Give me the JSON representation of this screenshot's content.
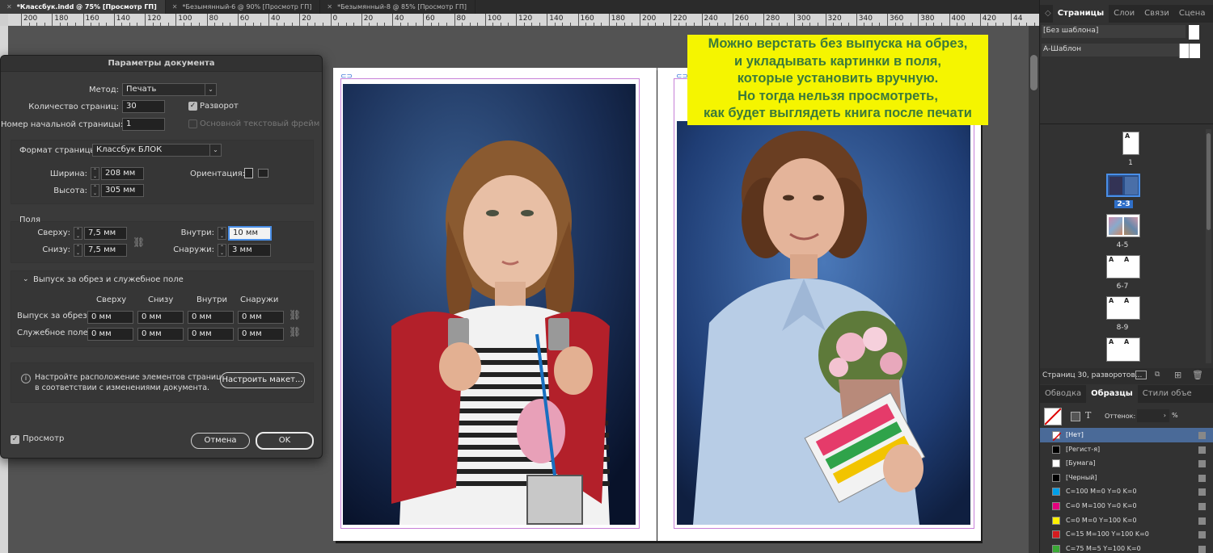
{
  "tabs": [
    {
      "label": "*Классбук.indd @ 75% [Просмотр ГП]"
    },
    {
      "label": "*Безымянный-6 @ 90% [Просмотр ГП]"
    },
    {
      "label": "*Безымянный-8 @ 85% [Просмотр ГП]"
    }
  ],
  "ruler": {
    "labels": [
      "200",
      "180",
      "160",
      "140",
      "120",
      "100",
      "80",
      "60",
      "40",
      "20",
      "0",
      "20",
      "40",
      "60",
      "80",
      "100",
      "120",
      "140",
      "160",
      "180",
      "200",
      "220",
      "240",
      "260",
      "280",
      "300",
      "320",
      "340",
      "360",
      "380",
      "400",
      "420",
      "44"
    ]
  },
  "note": {
    "lines": [
      "Можно верстать без выпуска на обрез,",
      "и укладывать картинки в поля,",
      "которые установить вручную.",
      "Но тогда нельзя просмотреть,",
      "как будет выглядеть книга после печати"
    ]
  },
  "dialog": {
    "title": "Параметры документа",
    "method_label": "Метод:",
    "method_value": "Печать",
    "pages_label": "Количество страниц:",
    "pages_value": "30",
    "spread_label": "Разворот",
    "start_page_label": "Номер начальной страницы:",
    "start_page_value": "1",
    "primary_text_frame_label": "Основной текстовый фрейм",
    "page_size_label": "Формат страницы:",
    "page_size_value": "Классбук БЛОК",
    "width_label": "Ширина:",
    "width_value": "208 мм",
    "height_label": "Высота:",
    "height_value": "305 мм",
    "orientation_label": "Ориентация:",
    "margins_label": "Поля",
    "top_label": "Сверху:",
    "top_value": "7,5 мм",
    "bottom_label": "Снизу:",
    "bottom_value": "7,5 мм",
    "inside_label": "Внутри:",
    "inside_value": "10 мм",
    "outside_label": "Снаружи:",
    "outside_value": "3 мм",
    "bleed_section_label": "Выпуск за обрез и служебное поле",
    "col_top": "Сверху",
    "col_bottom": "Снизу",
    "col_inside": "Внутри",
    "col_outside": "Снаружи",
    "bleed_label": "Выпуск за обрез:",
    "slug_label": "Служебное поле:",
    "bleed_values": [
      "0 мм",
      "0 мм",
      "0 мм",
      "0 мм"
    ],
    "slug_values": [
      "0 мм",
      "0 мм",
      "0 мм",
      "0 мм"
    ],
    "info_text_1": "Настройте расположение элементов страницы",
    "info_text_2": "в соответствии с изменениями документа.",
    "adjust_button": "Настроить макет...",
    "preview_label": "Просмотр",
    "cancel_button": "Отмена",
    "ok_button": "OK"
  },
  "pages_panel": {
    "tabs": [
      "Страницы",
      "Слои",
      "Связи",
      "Сцена"
    ],
    "none_master": "[Без шаблона]",
    "a_master": "A-Шаблон",
    "page_labels": [
      "1",
      "2-3",
      "4-5",
      "6-7",
      "8-9"
    ],
    "master_letter": "A",
    "footer": "Страниц 30, разворотов..."
  },
  "swatches_panel": {
    "tabs": [
      "Обводка",
      "Образцы",
      "Стили объе"
    ],
    "tint_label": "Оттенок:",
    "tint_unit": "%",
    "swatches": [
      {
        "name": "[Нет]",
        "color": "#ffffff"
      },
      {
        "name": "[Регист-я]",
        "color": "#000000"
      },
      {
        "name": "[Бумага]",
        "color": "#ffffff"
      },
      {
        "name": "[Черный]",
        "color": "#000000"
      },
      {
        "name": "C=100 M=0 Y=0 K=0",
        "color": "#00a0e9"
      },
      {
        "name": "C=0 M=100 Y=0 K=0",
        "color": "#e5007e"
      },
      {
        "name": "C=0 M=0 Y=100 K=0",
        "color": "#fff100"
      },
      {
        "name": "C=15 M=100 Y=100 K=0",
        "color": "#d51b1f"
      },
      {
        "name": "C=75 M=5 Y=100 K=0",
        "color": "#3aa935"
      }
    ]
  },
  "colors": {
    "note_bg": "#f5f500",
    "note_text": "#3b7a3b",
    "accent": "#2f6fc8",
    "margin_guide": "#c77fd8"
  }
}
